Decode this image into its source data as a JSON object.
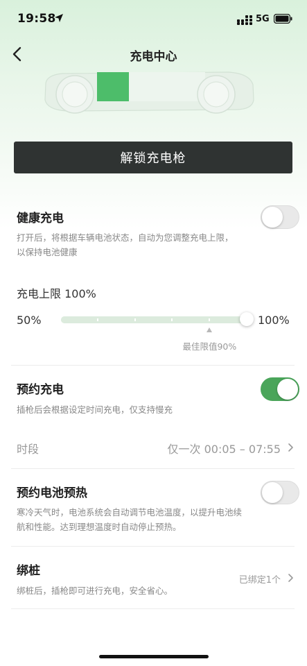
{
  "status_bar": {
    "time": "19:58",
    "network": "5G"
  },
  "nav": {
    "title": "充电中心"
  },
  "unlock_button": {
    "label": "解锁充电枪"
  },
  "health_charge": {
    "title": "健康充电",
    "description": "打开后，将根据车辆电池状态，自动为您调整充电上限，以保持电池健康",
    "enabled": false
  },
  "charge_limit": {
    "label": "充电上限 100%",
    "min_label": "50%",
    "max_label": "100%",
    "min": 50,
    "max": 100,
    "value": 100,
    "best_value": 90,
    "best_label": "最佳限值90%"
  },
  "scheduled_charge": {
    "title": "预约充电",
    "description": "插枪后会根据设定时间充电，仅支持慢充",
    "enabled": true,
    "period_label": "时段",
    "period_value": "仅一次 00:05 – 07:55"
  },
  "battery_preheat": {
    "title": "预约电池预热",
    "description": "寒冷天气时，电池系统会自动调节电池温度，以提升电池续航和性能。达到理想温度时自动停止预热。",
    "enabled": false
  },
  "bind_pile": {
    "title": "绑桩",
    "description": "绑桩后，插枪即可进行充电，安全省心。",
    "value": "已绑定1个"
  },
  "colors": {
    "accent": "#4aa55a",
    "button_dark": "#2f3332"
  }
}
